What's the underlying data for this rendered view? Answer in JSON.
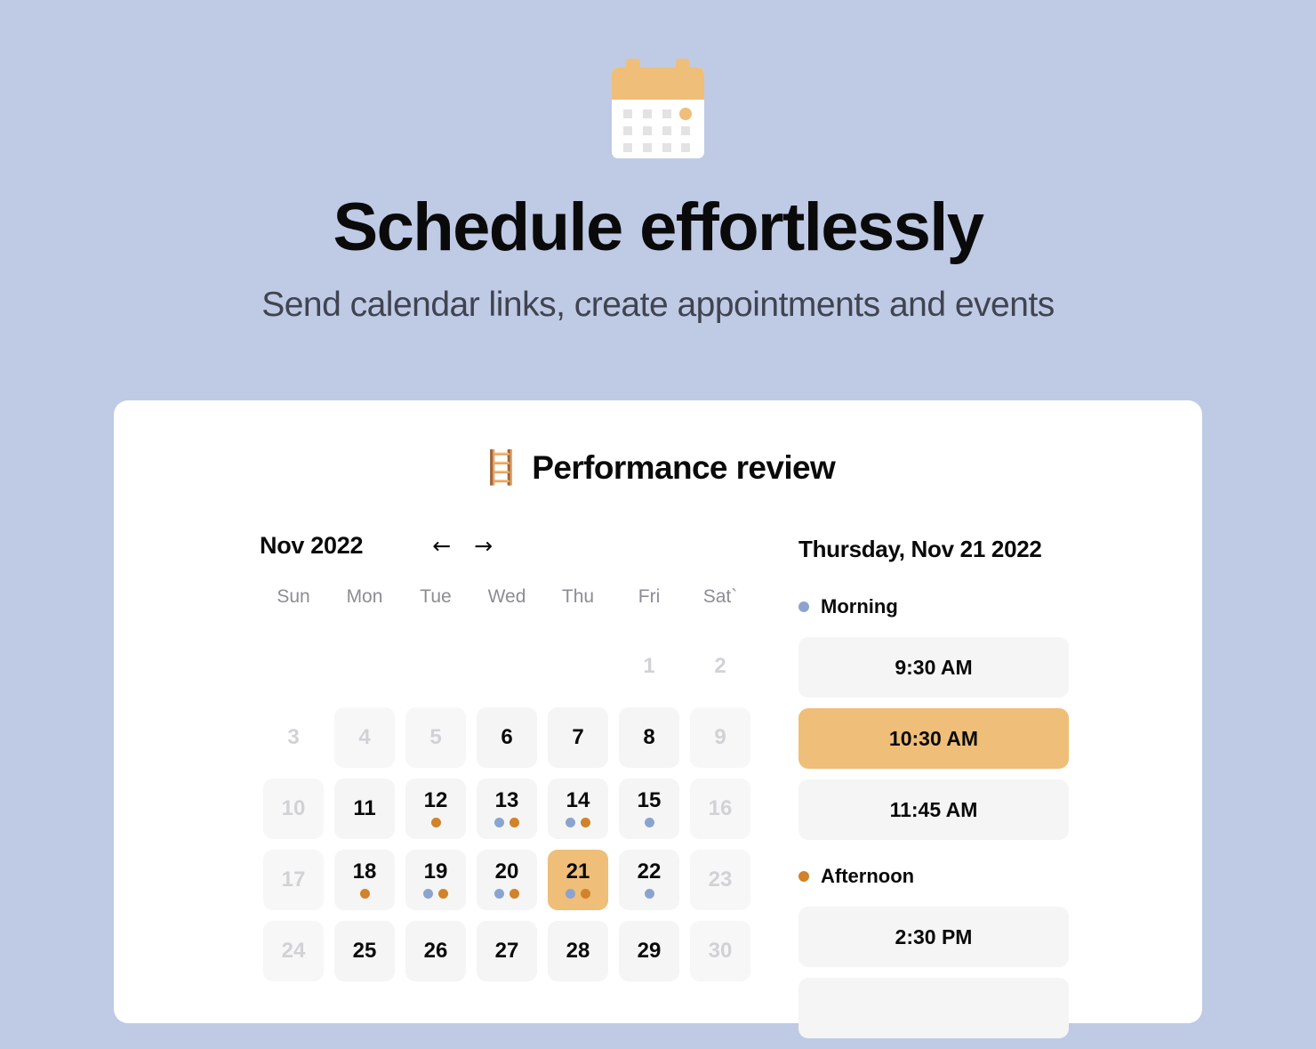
{
  "hero": {
    "icon_name": "calendar-icon",
    "headline": "Schedule effortlessly",
    "subhead": "Send calendar links, create appointments and events"
  },
  "card": {
    "title_emoji": "🪜",
    "title": "Performance review"
  },
  "calendar": {
    "month_label": "Nov 2022",
    "prev_label": "←",
    "next_label": "→",
    "weekdays": [
      "Sun",
      "Mon",
      "Tue",
      "Wed",
      "Thu",
      "Fri",
      "Sat`"
    ],
    "weeks": [
      [
        {
          "day": "",
          "state": "empty",
          "dots": []
        },
        {
          "day": "",
          "state": "empty",
          "dots": []
        },
        {
          "day": "",
          "state": "empty",
          "dots": []
        },
        {
          "day": "",
          "state": "empty",
          "dots": []
        },
        {
          "day": "",
          "state": "empty",
          "dots": []
        },
        {
          "day": "1",
          "state": "blank",
          "dots": []
        },
        {
          "day": "2",
          "state": "blank",
          "dots": []
        }
      ],
      [
        {
          "day": "3",
          "state": "blank",
          "dots": []
        },
        {
          "day": "4",
          "state": "disabled",
          "dots": []
        },
        {
          "day": "5",
          "state": "disabled",
          "dots": []
        },
        {
          "day": "6",
          "state": "enabled",
          "dots": []
        },
        {
          "day": "7",
          "state": "enabled",
          "dots": []
        },
        {
          "day": "8",
          "state": "enabled",
          "dots": []
        },
        {
          "day": "9",
          "state": "disabled",
          "dots": []
        }
      ],
      [
        {
          "day": "10",
          "state": "disabled",
          "dots": []
        },
        {
          "day": "11",
          "state": "enabled",
          "dots": []
        },
        {
          "day": "12",
          "state": "enabled",
          "dots": [
            "orange"
          ]
        },
        {
          "day": "13",
          "state": "enabled",
          "dots": [
            "blue",
            "orange"
          ]
        },
        {
          "day": "14",
          "state": "enabled",
          "dots": [
            "blue",
            "orange"
          ]
        },
        {
          "day": "15",
          "state": "enabled",
          "dots": [
            "blue"
          ]
        },
        {
          "day": "16",
          "state": "disabled",
          "dots": []
        }
      ],
      [
        {
          "day": "17",
          "state": "disabled",
          "dots": []
        },
        {
          "day": "18",
          "state": "enabled",
          "dots": [
            "orange"
          ]
        },
        {
          "day": "19",
          "state": "enabled",
          "dots": [
            "blue",
            "orange"
          ]
        },
        {
          "day": "20",
          "state": "enabled",
          "dots": [
            "blue",
            "orange"
          ]
        },
        {
          "day": "21",
          "state": "selected",
          "dots": [
            "blue",
            "orange"
          ]
        },
        {
          "day": "22",
          "state": "enabled",
          "dots": [
            "blue"
          ]
        },
        {
          "day": "23",
          "state": "disabled",
          "dots": []
        }
      ],
      [
        {
          "day": "24",
          "state": "disabled",
          "dots": []
        },
        {
          "day": "25",
          "state": "enabled",
          "dots": []
        },
        {
          "day": "26",
          "state": "enabled",
          "dots": []
        },
        {
          "day": "27",
          "state": "enabled",
          "dots": []
        },
        {
          "day": "28",
          "state": "enabled",
          "dots": []
        },
        {
          "day": "29",
          "state": "enabled",
          "dots": []
        },
        {
          "day": "30",
          "state": "disabled",
          "dots": []
        }
      ]
    ]
  },
  "slots_panel": {
    "date_label": "Thursday, Nov 21 2022",
    "groups": [
      {
        "label": "Morning",
        "dot_color": "blue",
        "times": [
          {
            "label": "9:30 AM",
            "selected": false
          },
          {
            "label": "10:30 AM",
            "selected": true
          },
          {
            "label": "11:45 AM",
            "selected": false
          }
        ]
      },
      {
        "label": "Afternoon",
        "dot_color": "orange",
        "times": [
          {
            "label": "2:30 PM",
            "selected": false
          },
          {
            "label": "",
            "selected": false
          }
        ]
      }
    ]
  },
  "colors": {
    "page_background": "#bfcae5",
    "card_background": "#ffffff",
    "accent": "#efbe79",
    "dot_blue": "#8ba4cf",
    "dot_orange": "#d2822a",
    "slot_background": "#f5f5f5"
  }
}
